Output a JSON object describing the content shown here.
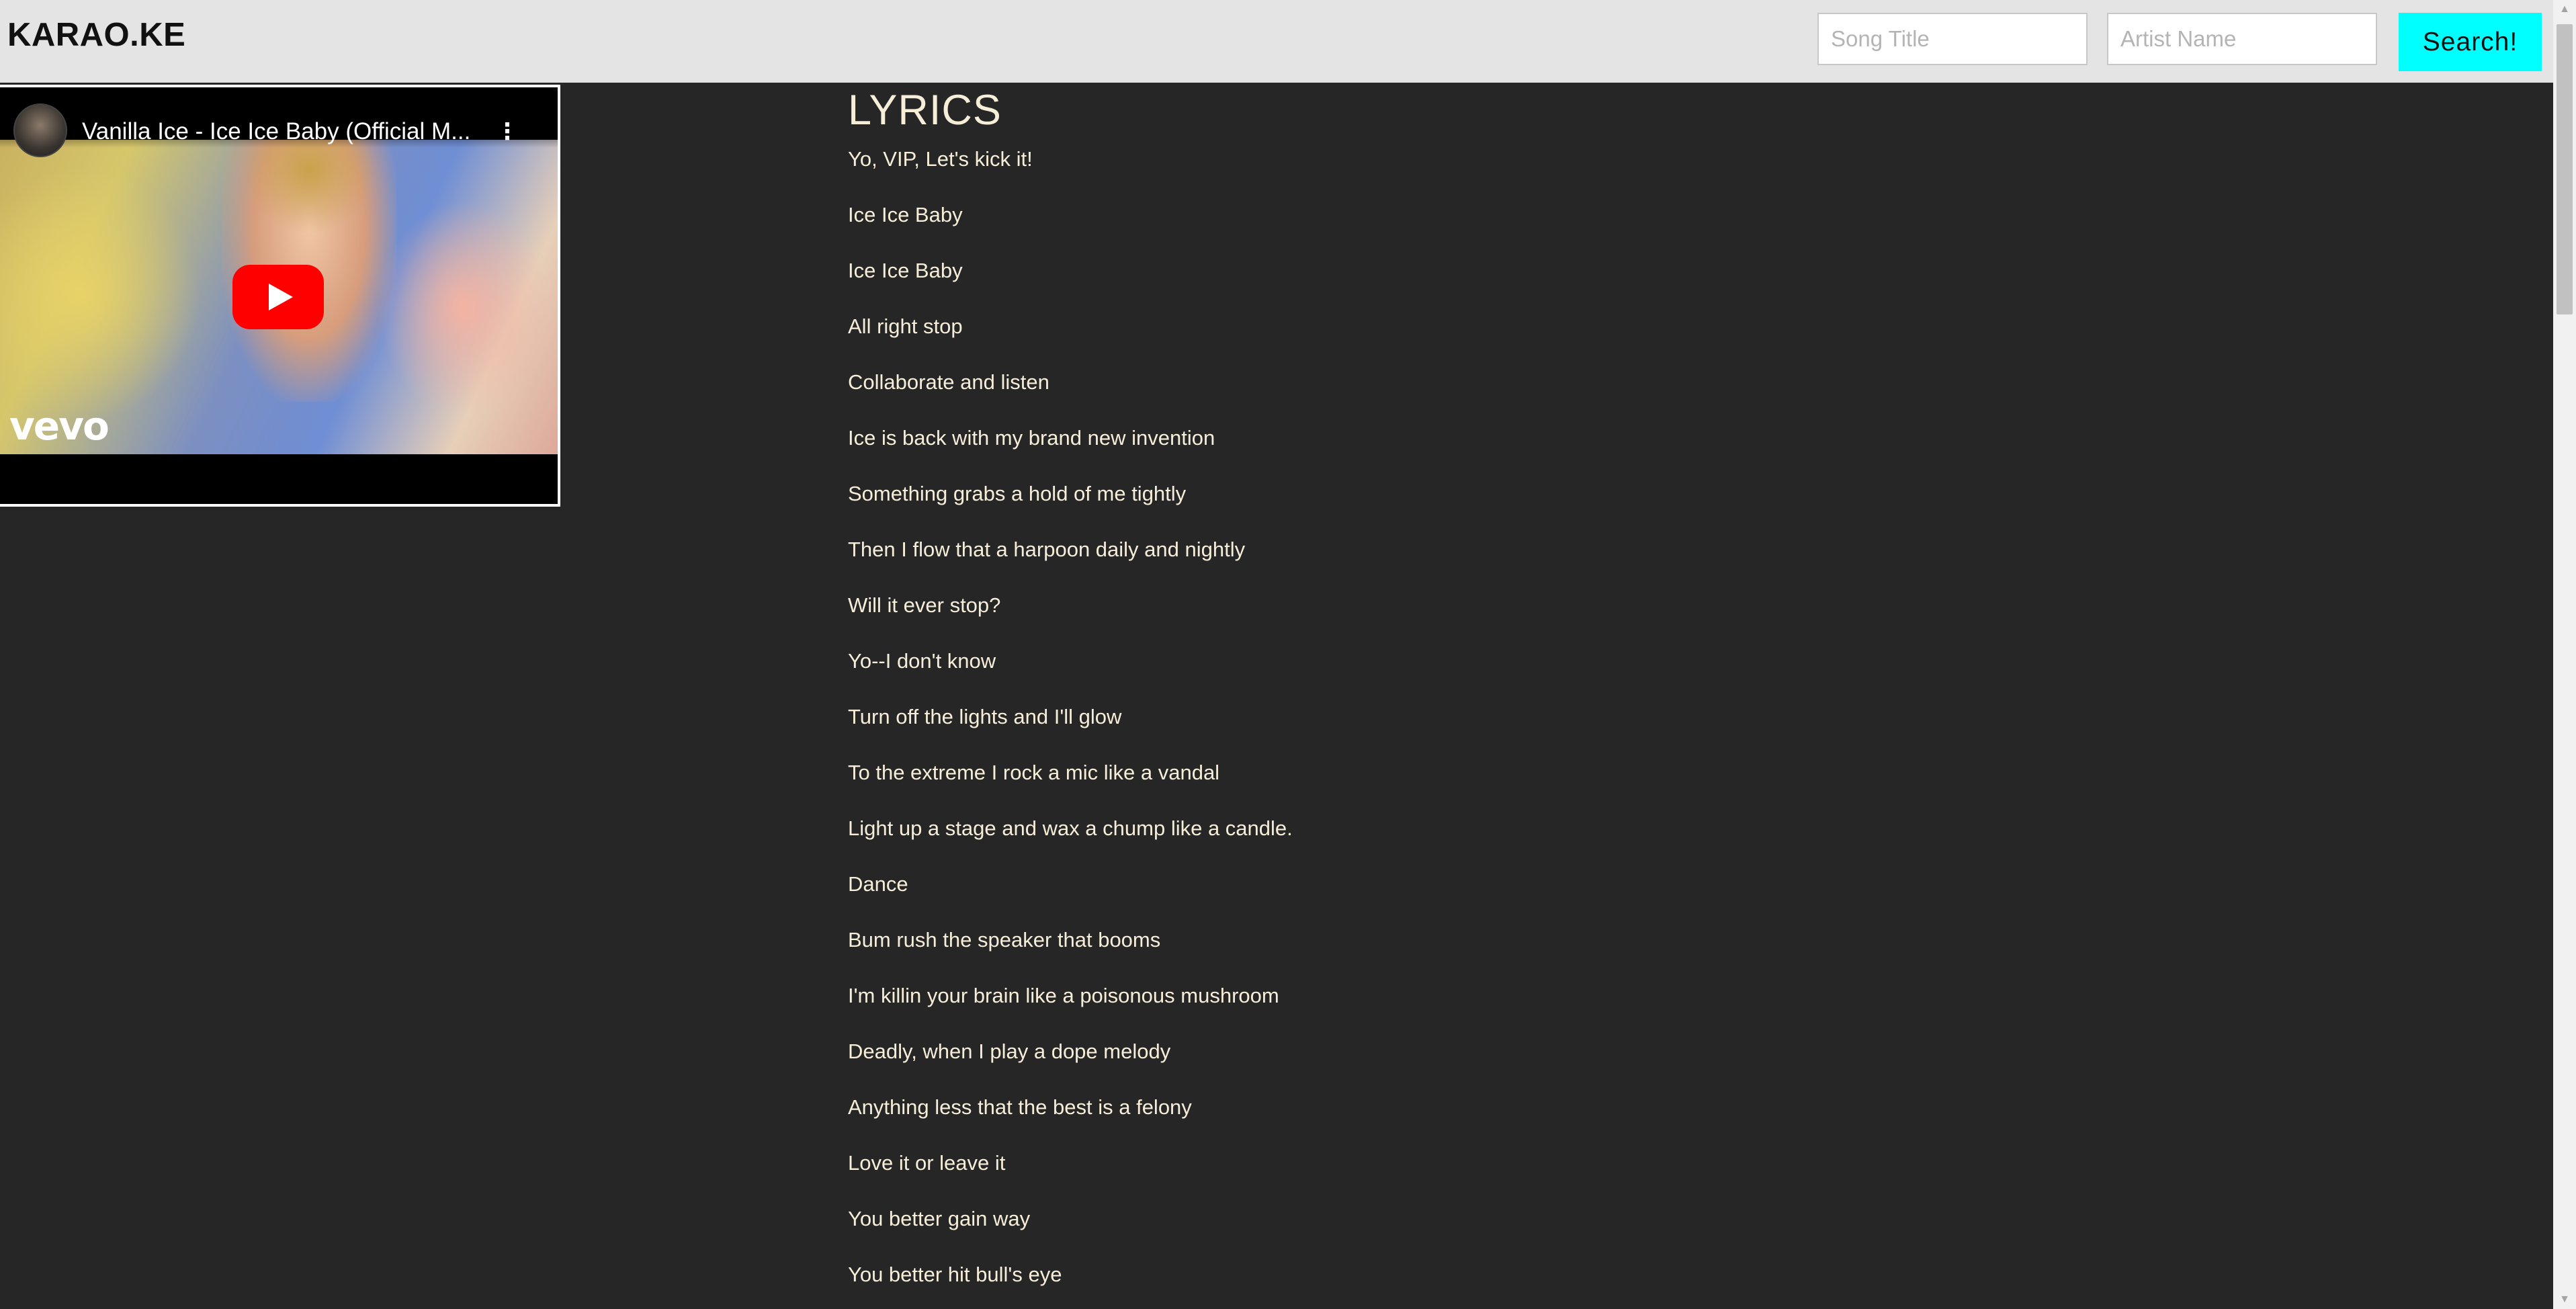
{
  "header": {
    "brand": "KARAO.KE",
    "song_placeholder": "Song Title",
    "artist_placeholder": "Artist Name",
    "search_label": "Search!"
  },
  "player": {
    "title": "Vanilla Ice - Ice Ice Baby (Official M...",
    "channel_logo_text": "vevo",
    "menu_icon": "kebab-menu-icon",
    "play_icon": "youtube-play-icon"
  },
  "lyrics": {
    "heading": "LYRICS",
    "lines": [
      "Yo, VIP, Let's kick it!",
      "Ice Ice Baby",
      "Ice Ice Baby",
      "All right stop",
      "Collaborate and listen",
      "Ice is back with my brand new invention",
      "Something grabs a hold of me tightly",
      "Then I flow that a harpoon daily and nightly",
      "Will it ever stop?",
      "Yo--I don't know",
      "Turn off the lights and I'll glow",
      "To the extreme I rock a mic like a vandal",
      "Light up a stage and wax a chump like a candle.",
      "Dance",
      "Bum rush the speaker that booms",
      "I'm killin your brain like a poisonous mushroom",
      "Deadly, when I play a dope melody",
      "Anything less that the best is a felony",
      "Love it or leave it",
      "You better gain way",
      "You better hit bull's eye"
    ]
  },
  "colors": {
    "background": "#262626",
    "header_bg": "#e4e4e4",
    "search_button": "#00ffff",
    "lyrics_text": "#f7eed9",
    "play_button": "#ff0000"
  }
}
